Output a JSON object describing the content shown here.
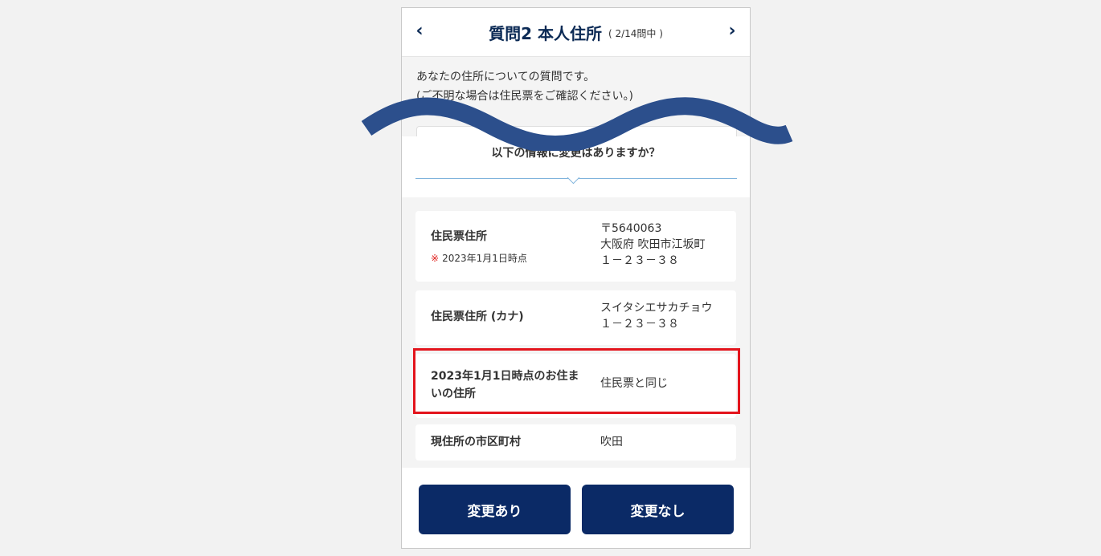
{
  "header": {
    "title": "質問2 本人住所",
    "counter": "( 2/14問中 )",
    "prev_icon": "chevron-left-icon",
    "next_icon": "chevron-right-icon"
  },
  "intro": {
    "line1": "あなたの住所についての質問です。",
    "line2": "(ご不明な場合は住民票をご確認ください。)"
  },
  "question": "以下の情報に変更はありますか？",
  "rows": [
    {
      "label": "住民票住所",
      "note_mark": "※",
      "note": "2023年1月1日時点",
      "value_lines": [
        "〒5640063",
        "大阪府 吹田市江坂町",
        "１－２３－３８"
      ]
    },
    {
      "label": "住民票住所 (カナ)",
      "value_lines": [
        "スイタシエサカチョウ",
        "１－２３－３８"
      ]
    },
    {
      "label_lines": [
        "2023年1月1日時点のお住ま",
        "いの住所"
      ],
      "value": "住民票と同じ"
    },
    {
      "label": "現住所の市区町村",
      "value": "吹田"
    }
  ],
  "buttons": {
    "changed": "変更あり",
    "unchanged": "変更なし"
  },
  "colors": {
    "brand_navy": "#0b2a66",
    "highlight_red": "#e3141c",
    "wave_blue": "#2c4f8c"
  }
}
